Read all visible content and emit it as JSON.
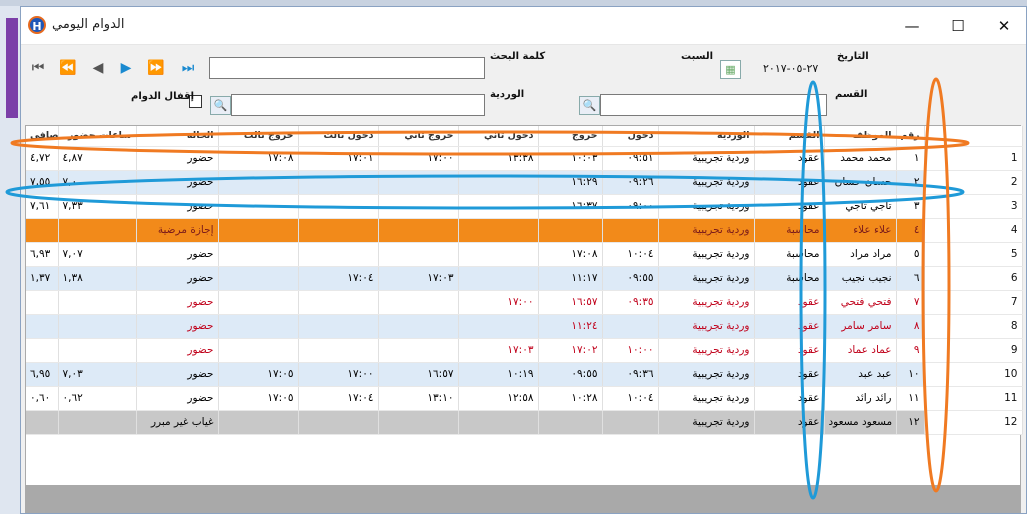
{
  "window": {
    "title": "الدوام اليومي",
    "app_icon": "H",
    "minimize": "—",
    "maximize": "☐",
    "close": "✕"
  },
  "toolbar": {
    "nav_first": "⏮",
    "nav_prev_fast": "⏪",
    "nav_prev": "◀",
    "nav_next": "▶",
    "nav_next_fast": "⏩",
    "nav_last": "⏭"
  },
  "filters": {
    "date_label": "التاريخ",
    "date_value": "٢٧-٠٥-٢٠١٧",
    "day_label": "السبت",
    "search_label": "كلمة البحث",
    "search_value": "",
    "section_label": "القسم",
    "section_value": "",
    "shift_label": "الوردية",
    "shift_value": "",
    "close_attendance_label": "إقفال الدوام"
  },
  "grid": {
    "columns": [
      "صافي",
      "ساعات حضور",
      "الحالة",
      "خروج ثالث",
      "دخول ثالث",
      "خروج ثاني",
      "دخول ثاني",
      "خروج",
      "دخول",
      "الوردية",
      "القسم",
      "الموظف",
      "رقم"
    ],
    "rows": [
      {
        "n": "1",
        "net": "٤,٧٢",
        "hours": "٤,٨٧",
        "status": "حضور",
        "out3": "١٧:٠٨",
        "in3": "١٧:٠١",
        "out2": "١٧:٠٠",
        "in2": "١٣:٣٨",
        "out": "١٠:٠٣",
        "in": "٠٩:٥١",
        "shift": "وردية تجريبية",
        "dept": "عقود",
        "emp": "محمد محمد",
        "id": "١",
        "style": "even"
      },
      {
        "n": "2",
        "net": "٧,٥٥",
        "hours": "٧,٠",
        "status": "حضور",
        "out3": "",
        "in3": "",
        "out2": "",
        "in2": "",
        "out": "١٦:٢٩",
        "in": "٠٩:٢٦",
        "shift": "وردية تجريبية",
        "dept": "عقود",
        "emp": "حسان حسان",
        "id": "٢",
        "style": "odd"
      },
      {
        "n": "3",
        "net": "٧,٦١",
        "hours": "٧,٣٣",
        "status": "حضور",
        "out3": "",
        "in3": "",
        "out2": "",
        "in2": "",
        "out": "١٦:٣٧",
        "in": "٠٩:٠٠",
        "shift": "وردية تجريبية",
        "dept": "عقود",
        "emp": "تاجي تاجي",
        "id": "٣",
        "style": "even"
      },
      {
        "n": "4",
        "net": "",
        "hours": "",
        "status": "إجازة مرضية",
        "out3": "",
        "in3": "",
        "out2": "",
        "in2": "",
        "out": "",
        "in": "",
        "shift": "وردية تجريبية",
        "dept": "محاسبة",
        "emp": "علاء علاء",
        "id": "٤",
        "style": "orange"
      },
      {
        "n": "5",
        "net": "٦,٩٣",
        "hours": "٧,٠٧",
        "status": "حضور",
        "out3": "",
        "in3": "",
        "out2": "",
        "in2": "",
        "out": "١٧:٠٨",
        "in": "١٠:٠٤",
        "shift": "وردية تجريبية",
        "dept": "محاسبة",
        "emp": "مراد مراد",
        "id": "٥",
        "style": "even"
      },
      {
        "n": "6",
        "net": "١,٣٧",
        "hours": "١,٣٨",
        "status": "حضور",
        "out3": "",
        "in3": "١٧:٠٤",
        "out2": "١٧:٠٣",
        "in2": "",
        "out": "١١:١٧",
        "in": "٠٩:٥٥",
        "shift": "وردية تجريبية",
        "dept": "محاسبة",
        "emp": "نجيب نجيب",
        "id": "٦",
        "style": "odd"
      },
      {
        "n": "7",
        "net": "",
        "hours": "",
        "status": "حضور",
        "out3": "",
        "in3": "",
        "out2": "",
        "in2": "١٧:٠٠",
        "out": "١٦:٥٧",
        "in": "٠٩:٣٥",
        "shift": "وردية تجريبية",
        "dept": "عقود",
        "emp": "فتحي فتحي",
        "id": "٧",
        "style": "red-even"
      },
      {
        "n": "8",
        "net": "",
        "hours": "",
        "status": "حضور",
        "out3": "",
        "in3": "",
        "out2": "",
        "in2": "",
        "out": "١١:٢٤",
        "in": "",
        "shift": "وردية تجريبية",
        "dept": "عقود",
        "emp": "سامر سامر",
        "id": "٨",
        "style": "red-odd"
      },
      {
        "n": "9",
        "net": "",
        "hours": "",
        "status": "حضور",
        "out3": "",
        "in3": "",
        "out2": "",
        "in2": "١٧:٠٣",
        "out": "١٧:٠٢",
        "in": "١٠:٠٠",
        "shift": "وردية تجريبية",
        "dept": "عقود",
        "emp": "عماد عماد",
        "id": "٩",
        "style": "red-even"
      },
      {
        "n": "10",
        "net": "٦,٩٥",
        "hours": "٧,٠٣",
        "status": "حضور",
        "out3": "١٧:٠٥",
        "in3": "١٧:٠٠",
        "out2": "١٦:٥٧",
        "in2": "١٠:١٩",
        "out": "٠٩:٥٥",
        "in": "٠٩:٣٦",
        "shift": "وردية تجريبية",
        "dept": "عقود",
        "emp": "عبد عبد",
        "id": "١٠",
        "style": "odd"
      },
      {
        "n": "11",
        "net": "٠,٦٠",
        "hours": "٠,٦٢",
        "status": "حضور",
        "out3": "١٧:٠٥",
        "in3": "١٧:٠٤",
        "out2": "١٣:١٠",
        "in2": "١٢:٥٨",
        "out": "١٠:٢٨",
        "in": "١٠:٠٤",
        "shift": "وردية تجريبية",
        "dept": "عقود",
        "emp": "رائد رائد",
        "id": "١١",
        "style": "even"
      },
      {
        "n": "12",
        "net": "",
        "hours": "",
        "status": "غياب غير مبرر",
        "out3": "",
        "in3": "",
        "out2": "",
        "in2": "",
        "out": "",
        "in": "",
        "shift": "وردية تجريبية",
        "dept": "عقود",
        "emp": "مسعود مسعود",
        "id": "١٢",
        "style": "gray"
      }
    ]
  },
  "colors": {
    "annotation_orange": "#f07a22",
    "annotation_blue": "#1f9ad8"
  }
}
